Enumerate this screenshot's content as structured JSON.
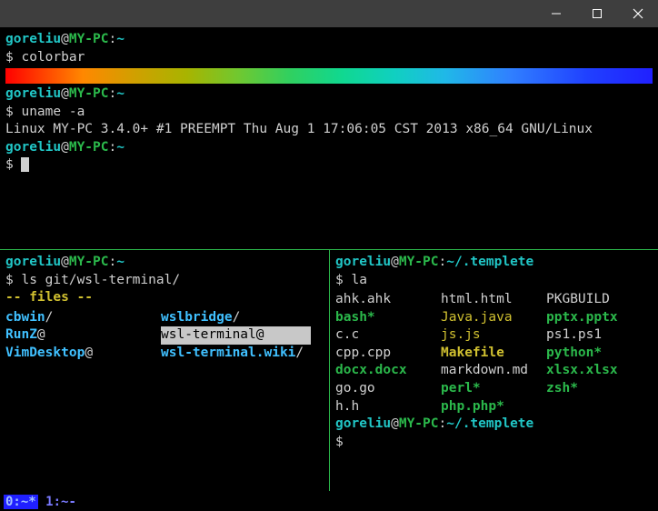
{
  "titlebar": {
    "title": ""
  },
  "top_pane": {
    "prompt1": {
      "user": "goreliu",
      "at": "@",
      "host": "MY-PC",
      "colon": ":",
      "path": "~"
    },
    "cmd1_prompt": "$ ",
    "cmd1": "colorbar",
    "prompt2": {
      "user": "goreliu",
      "at": "@",
      "host": "MY-PC",
      "colon": ":",
      "path": "~"
    },
    "cmd2_prompt": "$ ",
    "cmd2": "uname -a",
    "uname_out": "Linux MY-PC 3.4.0+ #1 PREEMPT Thu Aug 1 17:06:05 CST 2013 x86_64 GNU/Linux",
    "prompt3": {
      "user": "goreliu",
      "at": "@",
      "host": "MY-PC",
      "colon": ":",
      "path": "~"
    },
    "cmd3_prompt": "$ "
  },
  "left_pane": {
    "prompt": {
      "user": "goreliu",
      "at": "@",
      "host": "MY-PC",
      "colon": ":",
      "path": "~"
    },
    "cmd_prompt": "$ ",
    "cmd": "ls git/wsl-terminal/",
    "files_label": " -- files --",
    "col1": [
      {
        "name": "cbwin",
        "suffix": "/",
        "cls": "f-cyan-b"
      },
      {
        "name": "RunZ",
        "suffix": "@",
        "cls": "f-cyan-b",
        "bold": true
      },
      {
        "name": "VimDesktop",
        "suffix": "@",
        "cls": "f-cyan-b",
        "bold": true
      }
    ],
    "col2": [
      {
        "name": "wslbridge",
        "suffix": "/",
        "cls": "f-cyan-b"
      },
      {
        "name": "wsl-terminal",
        "suffix": "@",
        "cls": "sel"
      },
      {
        "name": "wsl-terminal.wiki",
        "suffix": "/",
        "cls": "f-cyan-b"
      }
    ]
  },
  "right_pane": {
    "prompt": {
      "user": "goreliu",
      "at": "@",
      "host": "MY-PC",
      "colon": ":",
      "path": "~/.templete"
    },
    "cmd_prompt": "$ ",
    "cmd": "la",
    "col1": [
      {
        "t": "ahk.ahk",
        "c": "f-gry"
      },
      {
        "t": "bash*",
        "c": "f-grn"
      },
      {
        "t": "c.c",
        "c": "f-gry"
      },
      {
        "t": "cpp.cpp",
        "c": "f-gry"
      },
      {
        "t": "docx.docx",
        "c": "f-grn"
      },
      {
        "t": "go.go",
        "c": "f-gry"
      },
      {
        "t": "h.h",
        "c": "f-gry"
      }
    ],
    "col2": [
      {
        "t": "html.html",
        "c": "f-gry"
      },
      {
        "t": "Java.java",
        "c": "f-yel"
      },
      {
        "t": "js.js",
        "c": "f-yel"
      },
      {
        "t": "Makefile",
        "c": "f-yel",
        "b": true
      },
      {
        "t": "markdown.md",
        "c": "f-gry"
      },
      {
        "t": "perl*",
        "c": "f-grn"
      },
      {
        "t": "php.php*",
        "c": "f-grn"
      }
    ],
    "col3": [
      {
        "t": "PKGBUILD",
        "c": "f-gry"
      },
      {
        "t": "pptx.pptx",
        "c": "f-grn"
      },
      {
        "t": "ps1.ps1",
        "c": "f-gry"
      },
      {
        "t": "python*",
        "c": "f-grn"
      },
      {
        "t": "xlsx.xlsx",
        "c": "f-grn"
      },
      {
        "t": "zsh*",
        "c": "f-grn"
      }
    ],
    "prompt2": {
      "user": "goreliu",
      "at": "@",
      "host": "MY-PC",
      "colon": ":",
      "path": "~/.templete"
    },
    "cmd2_prompt": "$ "
  },
  "statusbar": {
    "active": "0:~*",
    "sep": " ",
    "other": "1:~-"
  }
}
